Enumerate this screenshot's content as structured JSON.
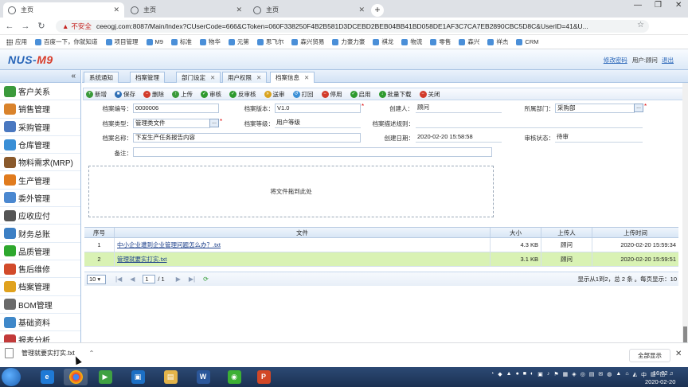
{
  "browser": {
    "tabs": [
      {
        "label": "主页"
      },
      {
        "label": "主页"
      },
      {
        "label": "主页"
      }
    ],
    "insecure_label": "不安全",
    "url": "ceeogj.com:8087/Main/Index?CUserCode=666&CToken=060F338250F4B2B581D3DCEBD2BEB04BB41BD058DE1AF3C7CA7EB2890CBC5D8C&UserID=41&U...",
    "bookmarks": [
      "应用",
      "百度一下，你就知道",
      "项目管理",
      "M9",
      "标准",
      "物华",
      "元第",
      "思飞尔",
      "森兴贸易",
      "力豪力豪",
      "祺龙",
      "物流",
      "零售",
      "森兴",
      "祥杰",
      "CRM"
    ]
  },
  "header": {
    "logo_text": "NUS-",
    "logo_accent": "M9",
    "change_password": "修改密码",
    "user_label": "用户:顾问",
    "logout": "退出"
  },
  "sidebar": {
    "collapse_glyph": "«",
    "items": [
      {
        "label": "客户关系",
        "color": "#3b9a3b"
      },
      {
        "label": "销售管理",
        "color": "#d9832c"
      },
      {
        "label": "采购管理",
        "color": "#4a78c0"
      },
      {
        "label": "仓库管理",
        "color": "#3a8fd6"
      },
      {
        "label": "物料需求(MRP)",
        "color": "#8a5a2c"
      },
      {
        "label": "生产管理",
        "color": "#e07b1e"
      },
      {
        "label": "委外管理",
        "color": "#4b88d0"
      },
      {
        "label": "应收应付",
        "color": "#555555"
      },
      {
        "label": "财务总账",
        "color": "#3c7fc4"
      },
      {
        "label": "品质管理",
        "color": "#2ea82e"
      },
      {
        "label": "售后维修",
        "color": "#d24b2b"
      },
      {
        "label": "档案管理",
        "color": "#e0a21e"
      },
      {
        "label": "BOM管理",
        "color": "#6a6a6a"
      },
      {
        "label": "基础资料",
        "color": "#3f88c9"
      },
      {
        "label": "报表分析",
        "color": "#c23a3a"
      }
    ]
  },
  "content_tabs": [
    {
      "label": "系统通知",
      "closable": false
    },
    {
      "label": "档案管理",
      "closable": false
    },
    {
      "label": "部门设定",
      "closable": true
    },
    {
      "label": "用户权限",
      "closable": true
    },
    {
      "label": "档案信息",
      "closable": true
    }
  ],
  "toolbar": [
    {
      "label": "新增",
      "icon": "add-icon",
      "color": "#3a9a3a",
      "glyph": "+"
    },
    {
      "label": "保存",
      "icon": "save-icon",
      "color": "#2f6fb5",
      "glyph": "■"
    },
    {
      "label": "删除",
      "icon": "delete-icon",
      "color": "#d23b2b",
      "glyph": "−"
    },
    {
      "label": "上传",
      "icon": "upload-icon",
      "color": "#3a9a3a",
      "glyph": "↑"
    },
    {
      "label": "审核",
      "icon": "approve-icon",
      "color": "#2e9a2e",
      "glyph": "✓"
    },
    {
      "label": "反审核",
      "icon": "unapprove-icon",
      "color": "#2e9a2e",
      "glyph": "✓"
    },
    {
      "label": "送审",
      "icon": "submit-icon",
      "color": "#d9a31e",
      "glyph": "»"
    },
    {
      "label": "打回",
      "icon": "return-icon",
      "color": "#3a8fd6",
      "glyph": "↺"
    },
    {
      "label": "停用",
      "icon": "disable-icon",
      "color": "#d23b2b",
      "glyph": "−"
    },
    {
      "label": "启用",
      "icon": "enable-icon",
      "color": "#2e9a2e",
      "glyph": "✓"
    },
    {
      "label": "批量下载",
      "icon": "download-icon",
      "color": "#2e9a2e",
      "glyph": "↓"
    },
    {
      "label": "关闭",
      "icon": "close-icon",
      "color": "#d23b2b",
      "glyph": "−"
    }
  ],
  "form": {
    "archive_no_label": "档案编号：",
    "archive_no": "0000006",
    "version_label": "档案版本：",
    "version": "V1.0",
    "creator_label": "创建人：",
    "creator": "顾问",
    "dept_label": "所属部门：",
    "dept": "采购部",
    "type_label": "档案类型：",
    "type": "管理类文件",
    "level_label": "档案等级：",
    "level": "用户等级",
    "rule_label": "档案描述规则：",
    "rule": "",
    "name_label": "档案名称：",
    "name": "下发生产任务报告内容",
    "created_label": "创建日期：",
    "created": "2020-02-20 15:58:58",
    "status_label": "审核状态：",
    "status": "待审",
    "remark_label": "备注：",
    "remark": "",
    "dots": "..."
  },
  "dropzone_text": "将文件拖到此处",
  "file_table": {
    "headers": [
      "序号",
      "文件",
      "大小",
      "上传人",
      "上传时间"
    ],
    "rows": [
      {
        "no": "1",
        "file": "中小企业遭到企业管理问题怎么办？.txt",
        "size": "4.3 KB",
        "uploader": "顾问",
        "time": "2020-02-20 15:59:34"
      },
      {
        "no": "2",
        "file": "管理就要实打实.txt",
        "size": "3.1 KB",
        "uploader": "顾问",
        "time": "2020-02-20 15:59:51"
      }
    ]
  },
  "pager": {
    "page_size": "10",
    "page": "1",
    "total_pages": "/ 1",
    "info": "显示从1到2，总 2 条 。每页显示：10"
  },
  "download_bar": {
    "file": "管理就要实打实.txt",
    "show_all": "全部显示"
  },
  "taskbar": {
    "tray_lang": "中",
    "time": "16:02",
    "date": "2020-02-20"
  }
}
